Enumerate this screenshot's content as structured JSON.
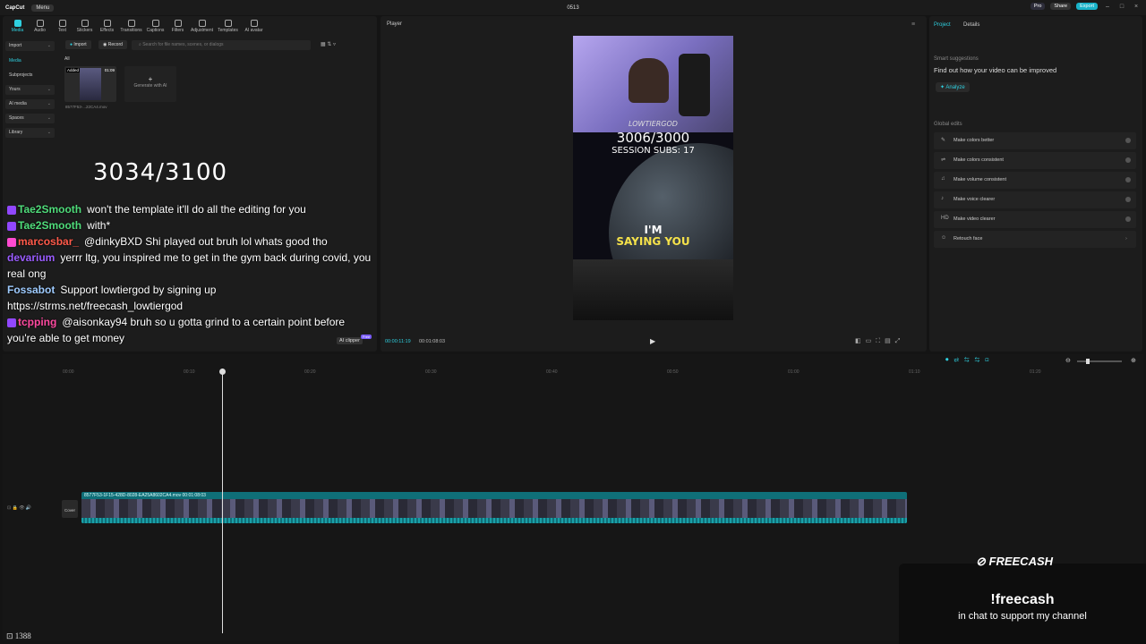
{
  "titlebar": {
    "app": "CapCut",
    "menu": "Menu",
    "project": "0513",
    "pro": "Pro",
    "share": "Share",
    "export": "Export"
  },
  "toolbar": {
    "tools": [
      "Media",
      "Audio",
      "Text",
      "Stickers",
      "Effects",
      "Transitions",
      "Captions",
      "Filters",
      "Adjustment",
      "Templates",
      "AI avatar"
    ]
  },
  "sidebar": {
    "items": [
      "Import",
      "Media",
      "Subprojects",
      "Yours",
      "AI media",
      "Spaces",
      "Library"
    ]
  },
  "media": {
    "import": "Import",
    "record": "Record",
    "search_placeholder": "Search for file names, scenes, or dialogs",
    "filter_all": "All",
    "added": "Added",
    "duration": "01:09",
    "filename": "8577F53-...22CA4.mov",
    "generate": "Generate with AI"
  },
  "overlay": {
    "counter": "3034/3100",
    "messages": [
      {
        "user": "Tae2Smooth",
        "color": "#4fdc7a",
        "text": "won't the template it'll do all the editing for you"
      },
      {
        "user": "Tae2Smooth",
        "color": "#4fdc7a",
        "text": "with*"
      },
      {
        "user": "marcosbar_",
        "color": "#ff5a4a",
        "text": "@dinkyBXD Shi played out bruh lol whats good tho"
      },
      {
        "user": "devarium",
        "color": "#9a5cff",
        "text": "yerrr ltg, you inspired me to get in the gym back during covid, you real ong"
      },
      {
        "user": "Fossabot",
        "color": "#9ecbff",
        "text": "Support lowtiergod by signing up https://strms.net/freecash_lowtiergod"
      },
      {
        "user": "tcpping",
        "color": "#ff4aa0",
        "text": "@aisonkay94 bruh so u gotta grind to a certain point before you're able to get money"
      }
    ],
    "ai_clipper": "AI clipper",
    "ai_free": "Free"
  },
  "player": {
    "title": "Player",
    "current": "00:00:11:19",
    "total": "00:01:08:03",
    "video": {
      "name": "LOWTIERGOD",
      "count": "3006/3000",
      "subs": "SESSION SUBS: 17",
      "caption1": "I'M",
      "caption2": "SAYING YOU"
    }
  },
  "right": {
    "tabs": [
      "Project",
      "Details"
    ],
    "smart": "Smart suggestions",
    "smart_text": "Find out how your video can be improved",
    "analyze": "Analyze",
    "global": "Global edits",
    "items": [
      "Make colors better",
      "Make colors consistent",
      "Make volume consistent",
      "Make voice clearer",
      "Make video clearer",
      "Retouch face"
    ]
  },
  "timeline": {
    "ticks": [
      "00:00",
      "00:10",
      "00:20",
      "00:30",
      "00:40",
      "00:50",
      "01:00",
      "01:10",
      "01:20"
    ],
    "track_name": "8577F53-1F15-428D-8028-EA25A8602CA4.mov  00:01:08:03",
    "cover": "Cover"
  },
  "freecash": {
    "brand": "FREECASH",
    "cmd": "!freecash",
    "sub": "in chat to support my channel"
  },
  "viewers": "1388"
}
